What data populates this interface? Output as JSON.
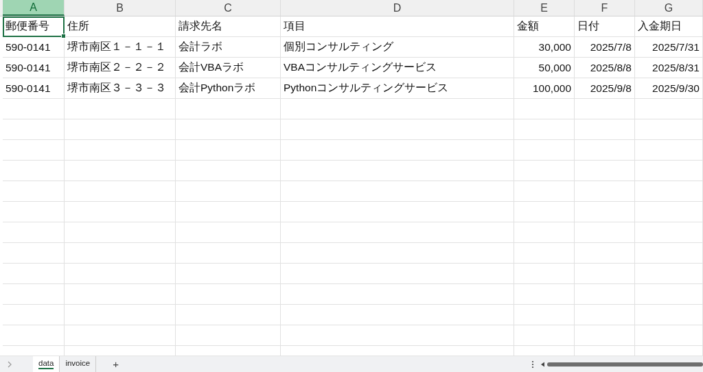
{
  "columns": [
    {
      "letter": "A",
      "selected": true
    },
    {
      "letter": "B",
      "selected": false
    },
    {
      "letter": "C",
      "selected": false
    },
    {
      "letter": "D",
      "selected": false
    },
    {
      "letter": "E",
      "selected": false
    },
    {
      "letter": "F",
      "selected": false
    },
    {
      "letter": "G",
      "selected": false
    }
  ],
  "rows": [
    {
      "cells": [
        {
          "text": "郵便番号",
          "kind": "text",
          "selected": true
        },
        {
          "text": "住所",
          "kind": "text",
          "selected": false
        },
        {
          "text": "請求先名",
          "kind": "text",
          "selected": false
        },
        {
          "text": "項目",
          "kind": "text",
          "selected": false
        },
        {
          "text": "金額",
          "kind": "text",
          "selected": false
        },
        {
          "text": "日付",
          "kind": "text",
          "selected": false
        },
        {
          "text": "入金期日",
          "kind": "text",
          "selected": false
        }
      ]
    },
    {
      "cells": [
        {
          "text": "590-0141",
          "kind": "text",
          "selected": false
        },
        {
          "text": "堺市南区１－１－１",
          "kind": "text",
          "selected": false
        },
        {
          "text": "会計ラボ",
          "kind": "text",
          "selected": false
        },
        {
          "text": "個別コンサルティング",
          "kind": "text",
          "selected": false
        },
        {
          "text": "30,000",
          "kind": "number",
          "selected": false
        },
        {
          "text": "2025/7/8",
          "kind": "number",
          "selected": false
        },
        {
          "text": "2025/7/31",
          "kind": "number",
          "selected": false
        }
      ]
    },
    {
      "cells": [
        {
          "text": "590-0141",
          "kind": "text",
          "selected": false
        },
        {
          "text": "堺市南区２－２－２",
          "kind": "text",
          "selected": false
        },
        {
          "text": "会計VBAラボ",
          "kind": "text",
          "selected": false
        },
        {
          "text": "VBAコンサルティングサービス",
          "kind": "text",
          "selected": false
        },
        {
          "text": "50,000",
          "kind": "number",
          "selected": false
        },
        {
          "text": "2025/8/8",
          "kind": "number",
          "selected": false
        },
        {
          "text": "2025/8/31",
          "kind": "number",
          "selected": false
        }
      ]
    },
    {
      "cells": [
        {
          "text": "590-0141",
          "kind": "text",
          "selected": false
        },
        {
          "text": "堺市南区３－３－３",
          "kind": "text",
          "selected": false
        },
        {
          "text": "会計Pythonラボ",
          "kind": "text",
          "selected": false
        },
        {
          "text": "Pythonコンサルティングサービス",
          "kind": "text",
          "selected": false
        },
        {
          "text": "100,000",
          "kind": "number",
          "selected": false
        },
        {
          "text": "2025/9/8",
          "kind": "number",
          "selected": false
        },
        {
          "text": "2025/9/30",
          "kind": "number",
          "selected": false
        }
      ]
    }
  ],
  "sheet_tabs": [
    {
      "label": "data",
      "selected": true
    },
    {
      "label": "invoice",
      "selected": false
    }
  ],
  "add_sheet": "+"
}
